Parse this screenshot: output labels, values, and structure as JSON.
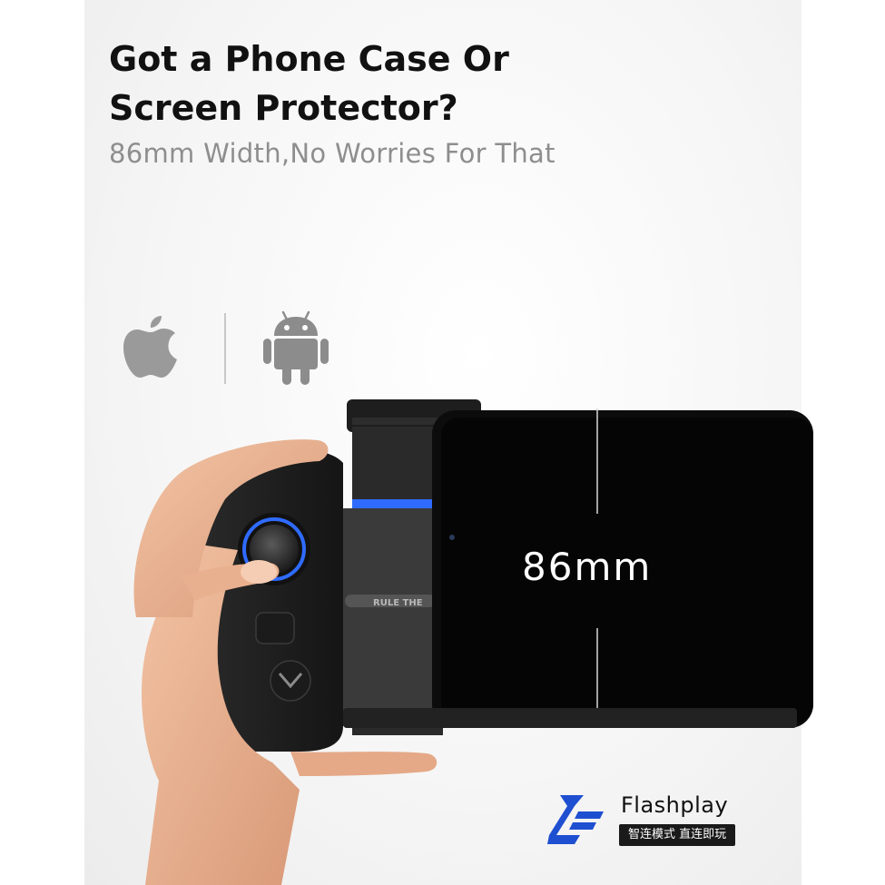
{
  "headline": {
    "line1": "Got a Phone Case Or",
    "line2": "Screen Protector?"
  },
  "subline": "86mm Width,No Worries For That",
  "platforms": {
    "apple_icon": "apple-logo-icon",
    "android_icon": "android-robot-icon"
  },
  "product": {
    "width_label": "86mm",
    "side_text": "RULE THE"
  },
  "brand": {
    "name": "Flashplay",
    "slogan": "智连模式 直连即玩",
    "mark_color": "#1f4fd1"
  },
  "colors": {
    "accent_blue": "#2f6bff",
    "device_black": "#151515"
  }
}
